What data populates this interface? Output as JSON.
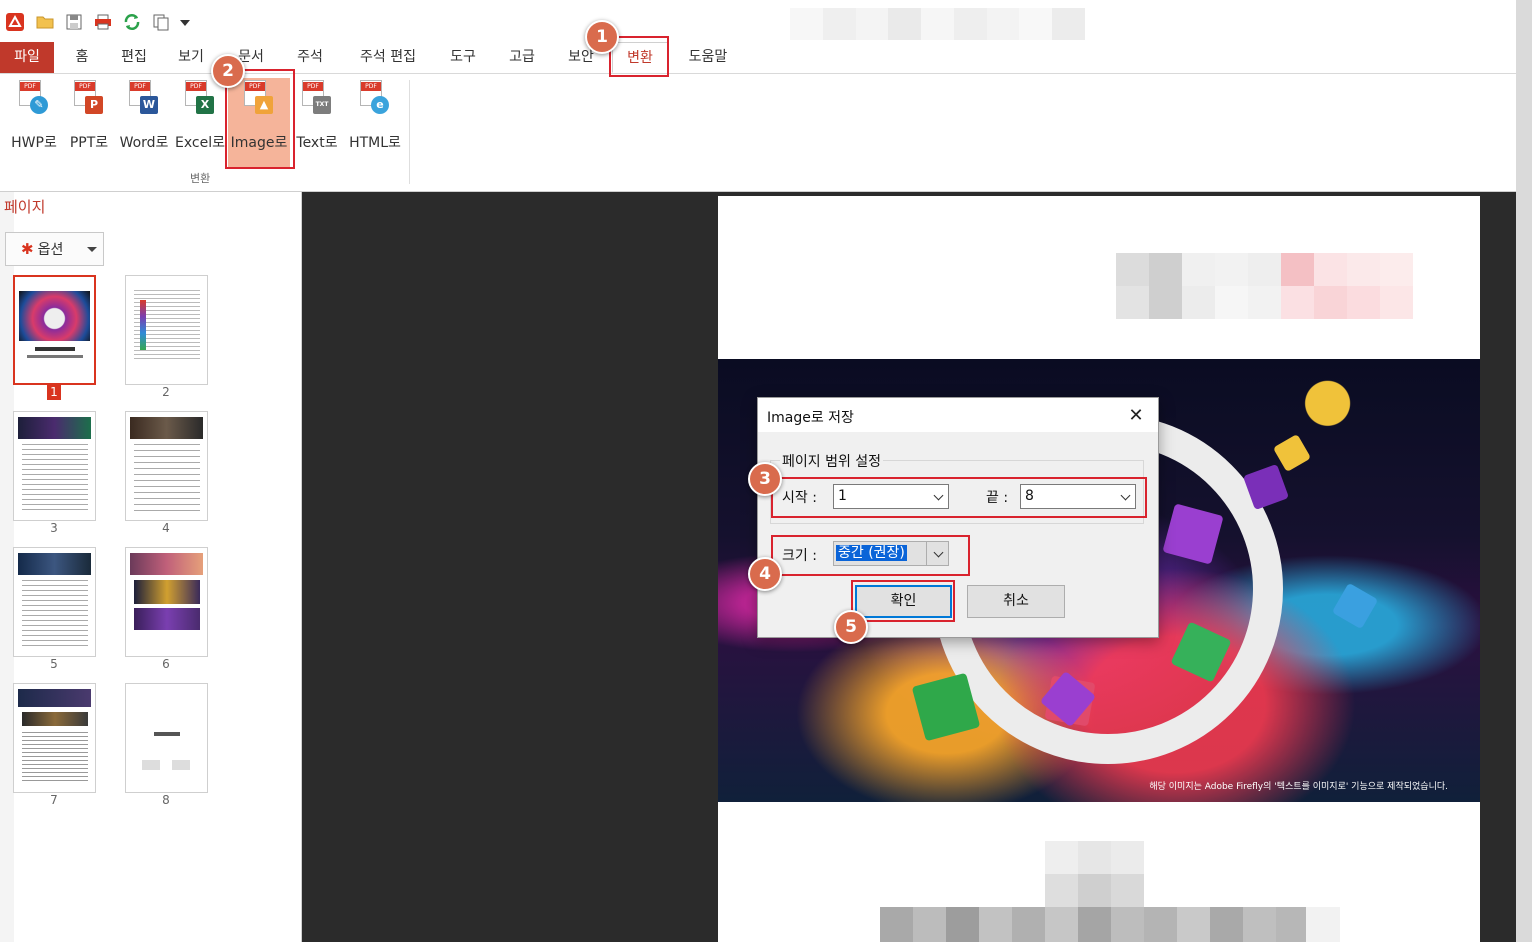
{
  "ribbon": {
    "tabs": [
      {
        "label": "파일"
      },
      {
        "label": "홈"
      },
      {
        "label": "편집"
      },
      {
        "label": "보기"
      },
      {
        "label": "문서"
      },
      {
        "label": "주석"
      },
      {
        "label": "주석 편집"
      },
      {
        "label": "도구"
      },
      {
        "label": "고급"
      },
      {
        "label": "보안"
      },
      {
        "label": "변환"
      },
      {
        "label": "도움말"
      }
    ],
    "active_tab": "변환",
    "group_label": "변환",
    "buttons": [
      {
        "label": "HWP로",
        "icon": "pdf-to-hwp-icon"
      },
      {
        "label": "PPT로",
        "icon": "pdf-to-ppt-icon"
      },
      {
        "label": "Word로",
        "icon": "pdf-to-word-icon"
      },
      {
        "label": "Excel로",
        "icon": "pdf-to-excel-icon"
      },
      {
        "label": "Image로",
        "icon": "pdf-to-image-icon"
      },
      {
        "label": "Text로",
        "icon": "pdf-to-text-icon"
      },
      {
        "label": "HTML로",
        "icon": "pdf-to-html-icon"
      }
    ],
    "selected_button": "Image로",
    "icon_glyphs": {
      "pdf": "PDF",
      "ppt": "P",
      "word": "W",
      "excel": "X",
      "text": "TXT"
    }
  },
  "sidebar": {
    "title": "페이지",
    "options_label": "옵션",
    "pages": [
      {
        "num": "1",
        "selected": true
      },
      {
        "num": "2",
        "selected": false
      },
      {
        "num": "3",
        "selected": false
      },
      {
        "num": "4",
        "selected": false
      },
      {
        "num": "5",
        "selected": false
      },
      {
        "num": "6",
        "selected": false
      },
      {
        "num": "7",
        "selected": false
      },
      {
        "num": "8",
        "selected": false
      }
    ]
  },
  "document": {
    "cover_caption": "해당 이미지는 Adobe Firefly의 '텍스트를 이미지로' 기능으로 제작되었습니다."
  },
  "dialog": {
    "title": "Image로 저장",
    "close_glyph": "✕",
    "range_group_label": "페이지 범위 설정",
    "start_label": "시작 :",
    "start_value": "1",
    "end_label": "끝 :",
    "end_value": "8",
    "size_label": "크기 :",
    "size_value": "중간 (권장)",
    "ok_label": "확인",
    "cancel_label": "취소"
  },
  "annotations": {
    "steps": [
      "1",
      "2",
      "3",
      "4",
      "5"
    ],
    "color": "#d9232e",
    "badge_color": "#d96b4d"
  },
  "colors": {
    "accent": "#c0392b",
    "viewer_bg": "#2b2b2b",
    "selection": "#0a64d8"
  }
}
